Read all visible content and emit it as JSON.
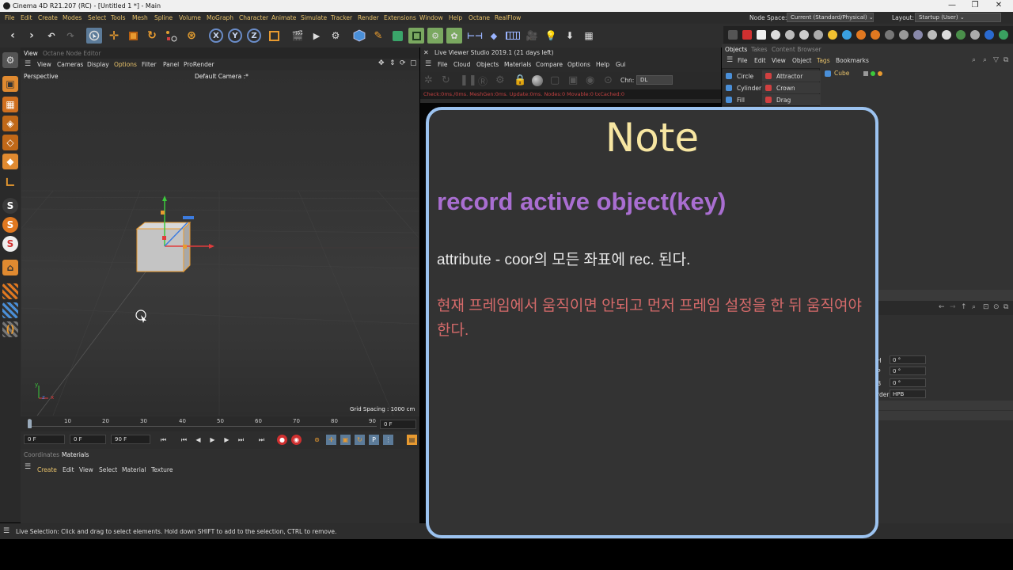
{
  "window": {
    "title": "Cinema 4D R21.207 (RC) - [Untitled 1 *] - Main",
    "minimize": "—",
    "maximize": "❐",
    "close": "✕"
  },
  "menubar": {
    "items": [
      "File",
      "Edit",
      "Create",
      "Modes",
      "Select",
      "Tools",
      "Mesh",
      "Spline",
      "Volume",
      "MoGraph",
      "Character",
      "Animate",
      "Simulate",
      "Tracker",
      "Render",
      "Extensions",
      "Window",
      "Help",
      "Octane",
      "RealFlow"
    ],
    "node_space_label": "Node Space:",
    "node_space_value": "Current (Standard/Physical)",
    "layout_label": "Layout:",
    "layout_value": "Startup (User)"
  },
  "toolbar": {
    "undo": "↶",
    "redo": "↷",
    "x": "X",
    "y": "Y",
    "z": "Z"
  },
  "viewport": {
    "tabs": [
      "View",
      "Octane Node Editor"
    ],
    "menu": [
      "View",
      "Cameras",
      "Display",
      "Options",
      "Filter",
      "Panel",
      "ProRender"
    ],
    "label": "Perspective",
    "camera": "Default Camera :*",
    "grid_spacing": "Grid Spacing : 1000 cm",
    "axis_x": "x",
    "axis_y": "y",
    "axis_z": "z"
  },
  "timeline": {
    "ticks": [
      "0",
      "10",
      "20",
      "30",
      "40",
      "50",
      "60",
      "70",
      "80",
      "90"
    ],
    "current_frame": "0 F",
    "start_field": "0 F",
    "min_field": "0 F",
    "end_field": "90 F"
  },
  "materials": {
    "tabs": [
      "Coordinates",
      "Materials"
    ],
    "menu": [
      "Create",
      "Edit",
      "View",
      "Select",
      "Material",
      "Texture"
    ]
  },
  "status_text": "Live Selection: Click and drag to select elements. Hold down SHIFT to add to the selection, CTRL to remove.",
  "live_viewer": {
    "title": "Live Viewer Studio 2019.1 (21 days left)",
    "close": "✕",
    "menu": [
      "File",
      "Cloud",
      "Objects",
      "Materials",
      "Compare",
      "Options",
      "Help",
      "Gui"
    ],
    "channel_label": "Chn:",
    "channel_value": "DL",
    "status": "Check:0ms./0ms. MeshGen:0ms. Update:0ms. Nodes:0 Movable:0 txCached:0"
  },
  "objects": {
    "tabs": [
      "Objects",
      "Takes",
      "Content Browser"
    ],
    "menu": [
      "File",
      "Edit",
      "View",
      "Object",
      "Tags",
      "Bookmarks"
    ],
    "tree_item": "Cube",
    "popup_left": [
      "Circle",
      "Cylinder",
      "Fill"
    ],
    "popup_right": [
      "Attractor",
      "Crown",
      "Drag"
    ]
  },
  "attributes": {
    "rows": [
      {
        "label": "H",
        "value": "0 °"
      },
      {
        "label": "P",
        "value": "0 °"
      },
      {
        "label": "B",
        "value": "0 °"
      }
    ],
    "order_label": "rder",
    "order_value": "HPB"
  },
  "note": {
    "title": "Note",
    "heading": "record active object(key)",
    "line1": "attribute - coor의 모든 좌표에 rec. 된다.",
    "warning": "현재 프레임에서 움직이면 안되고 먼저 프레임 설정을 한 뒤 움직여야 한다."
  },
  "colors": {
    "menu_text": "#e8c26a",
    "note_border": "#9cc3f0",
    "note_title": "#f7e6a2",
    "note_heading": "#a96ed1",
    "note_warning": "#d56a6a",
    "selection": "#5c7b99"
  }
}
